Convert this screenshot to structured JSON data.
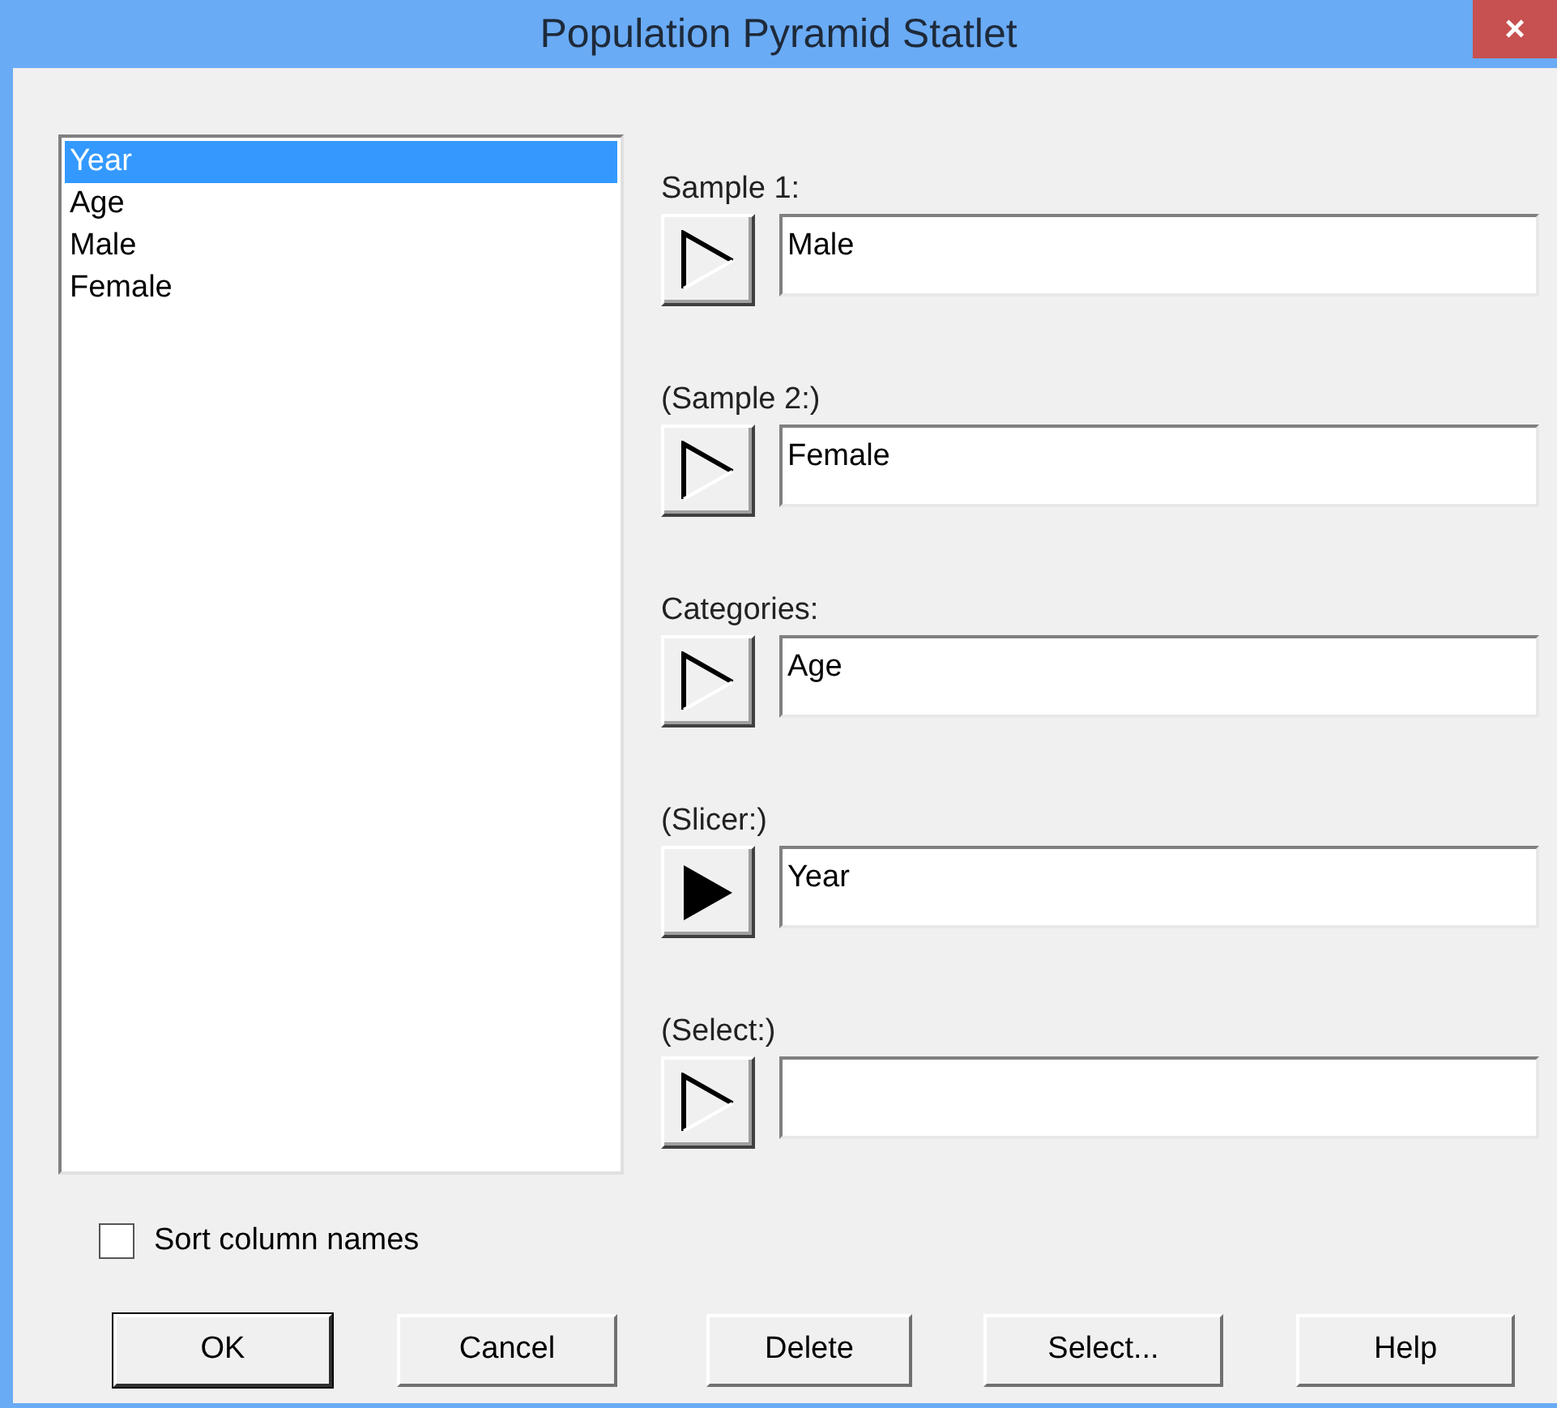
{
  "window": {
    "title": "Population Pyramid Statlet",
    "close": "×"
  },
  "columns": [
    {
      "label": "Year",
      "selected": true
    },
    {
      "label": "Age",
      "selected": false
    },
    {
      "label": "Male",
      "selected": false
    },
    {
      "label": "Female",
      "selected": false
    }
  ],
  "fields": [
    {
      "label": "Sample 1:",
      "value": "Male",
      "kind": "outline"
    },
    {
      "label": "(Sample 2:)",
      "value": "Female",
      "kind": "outline"
    },
    {
      "label": "Categories:",
      "value": "Age",
      "kind": "outline"
    },
    {
      "label": "(Slicer:)",
      "value": "Year",
      "kind": "filled"
    },
    {
      "label": "(Select:)",
      "kind": "outline"
    }
  ],
  "sort": {
    "label": "Sort column names",
    "checked": false
  },
  "buttons": [
    {
      "label": "OK",
      "default": true
    },
    {
      "label": "Cancel",
      "default": false
    },
    {
      "label": "Delete",
      "default": false
    },
    {
      "label": "Select...",
      "default": false
    },
    {
      "label": "Help",
      "default": false
    }
  ]
}
